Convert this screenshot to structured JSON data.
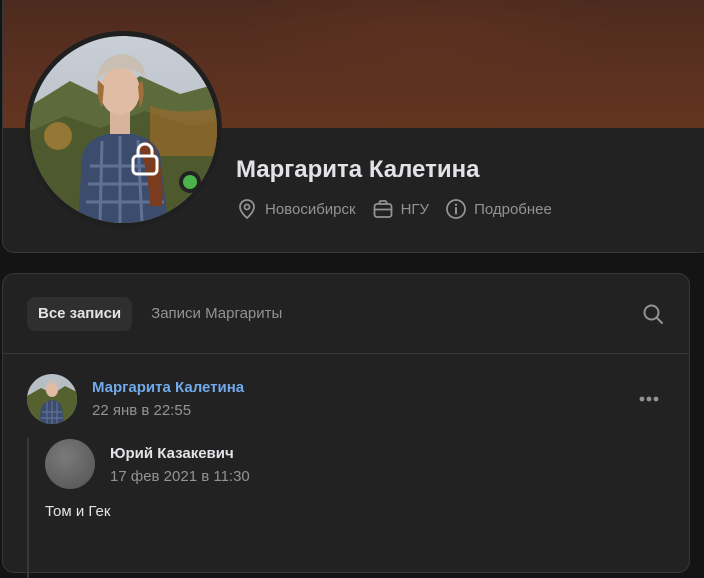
{
  "profile": {
    "name": "Маргарита Калетина",
    "online": true,
    "meta": {
      "city": "Новосибирск",
      "education": "НГУ",
      "more": "Подробнее"
    },
    "avatar_locked": true
  },
  "wall": {
    "tabs": [
      {
        "label": "Все записи",
        "active": true
      },
      {
        "label": "Записи Маргариты",
        "active": false
      }
    ],
    "post": {
      "author": "Маргарита Калетина",
      "date": "22 янв в 22:55",
      "repost": {
        "author": "Юрий Казакевич",
        "date": "17 фев 2021 в 11:30",
        "text": "Том и Гек"
      }
    }
  },
  "colors": {
    "background": "#141414",
    "card": "#222222",
    "accent_link": "#71aaeb",
    "online": "#4bb34b",
    "text_primary": "#e1e3e6",
    "text_secondary": "#939393"
  },
  "icons": {
    "lock": "lock-icon",
    "location": "location-pin-icon",
    "education": "briefcase-icon",
    "info": "info-icon",
    "search": "search-icon",
    "more": "more-dots-icon"
  }
}
